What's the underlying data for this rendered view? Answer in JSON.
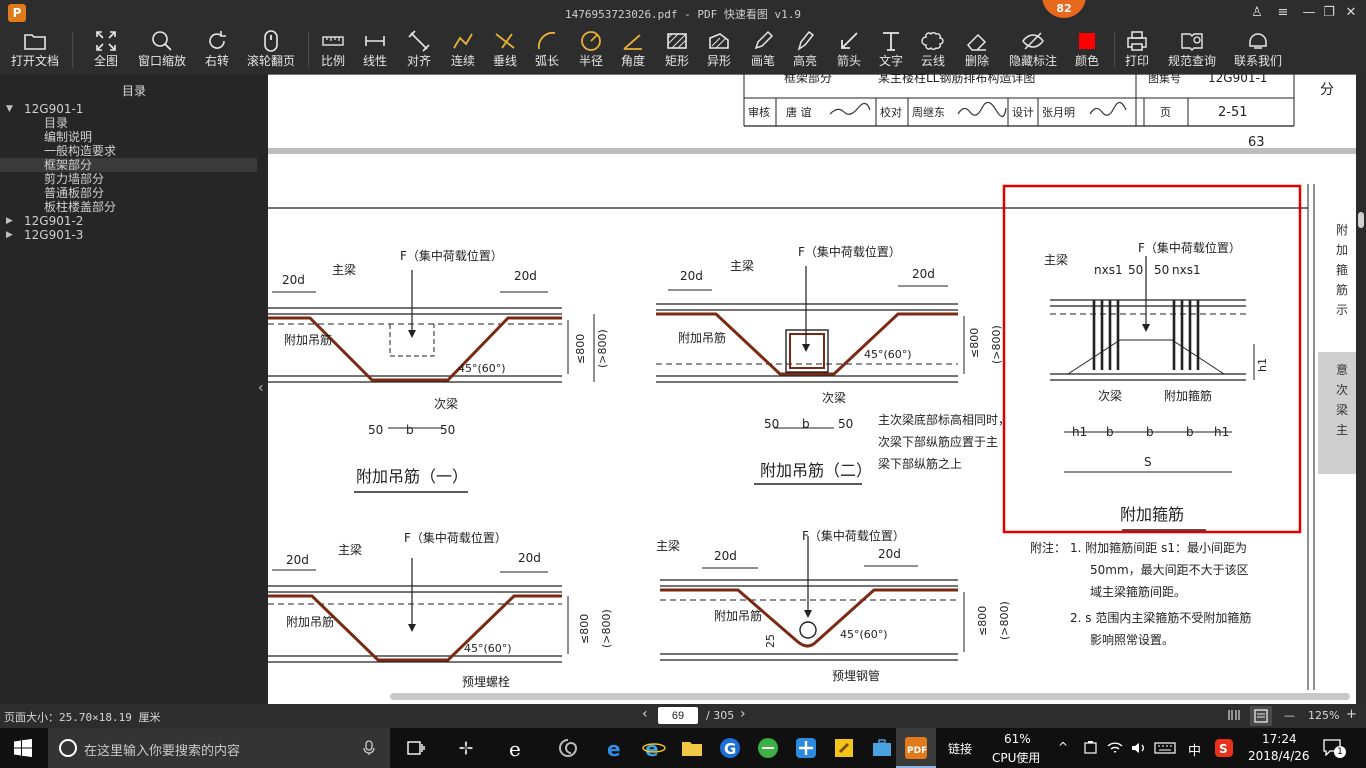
{
  "window": {
    "title": "1476953723026.pdf - PDF 快速看图 v1.9",
    "badge": "82",
    "logo": "P",
    "controls": {
      "user": "♙",
      "menu": "≡",
      "minimize": "—",
      "restore": "❐",
      "close": "✕"
    }
  },
  "toolbar": {
    "open": "打开文档",
    "fit_all": "全图",
    "window_zoom": "窗口缩放",
    "rotate_right": "右转",
    "scroll_page": "滚轮翻页",
    "scale": "比例",
    "linear": "线性",
    "align": "对齐",
    "continuous": "连续",
    "perpendicular": "垂线",
    "arc_length": "弧长",
    "radius": "半径",
    "angle": "角度",
    "rectangle": "矩形",
    "irregular": "异形",
    "pen": "画笔",
    "highlight": "高亮",
    "arrow": "箭头",
    "text": "文字",
    "cloud": "云线",
    "delete": "删除",
    "hide_marks": "隐藏标注",
    "color": "颜色",
    "print": "打印",
    "standard_query": "规范查询",
    "contact": "联系我们",
    "color_value": "#ff0000"
  },
  "sidebar": {
    "header": "目录",
    "root1": "12G901-1",
    "items": [
      "目录",
      "编制说明",
      "一般构造要求",
      "框架部分",
      "剪力墙部分",
      "普通板部分",
      "板柱楼盖部分"
    ],
    "root2": "12G901-2",
    "root3": "12G901-3"
  },
  "drawing": {
    "title_block": {
      "top_left": "框架部分",
      "top_center": "某主楼柱LL钢筋排布构造详图",
      "top_atlas": "图集号",
      "top_atlas_no": "12G901-1",
      "side": "分",
      "review": "审核",
      "reviewer": "唐 谊",
      "check": "校对",
      "checker": "周继东",
      "design": "设计",
      "designer": "张月明",
      "page": "页",
      "page_no": "2-51",
      "page_number": "63"
    },
    "labels": {
      "F_load": "F（集中荷载位置）",
      "F": "F",
      "load": "（集中荷载位置）",
      "main_beam": "主梁",
      "secondary_beam": "次梁",
      "hanger": "附加吊筋",
      "hoop": "附加箍筋",
      "d20": "20d",
      "angle": "45°(60°)",
      "le800": "≤800",
      "gt800": "(>800)",
      "d50": "50",
      "b": "b",
      "h1": "h1",
      "s": "S",
      "nxs1": "nxs1",
      "d25": "25",
      "bolt": "预埋螺栓",
      "pipe": "预埋钢管"
    },
    "captions": {
      "hanger_one": "附加吊筋（一）",
      "hanger_two": "附加吊筋（二）",
      "hoop": "附加箍筋"
    },
    "note_side": [
      "主次梁底部标高相同时，",
      "次梁下部纵筋应置于主",
      "梁下部纵筋之上"
    ],
    "notes": {
      "head": "附注：",
      "n1a": "1. 附加箍筋间距 s1：最小间距为",
      "n1b": "50mm，最大间距不大于该区",
      "n1c": "域主梁箍筋间距。",
      "n2a": "2. s 范围内主梁箍筋不受附加箍筋",
      "n2b": "影响照常设置。"
    },
    "edge_text": [
      "附",
      "加",
      "箍",
      "筋",
      "示",
      "意",
      "次",
      "梁",
      "主"
    ],
    "highlight_color": "#e00000"
  },
  "statusbar": {
    "page_size": "页面大小：25.70×18.19 厘米",
    "current_page": "69",
    "total_pages": "/ 305",
    "prev": "‹",
    "next": "›",
    "zoom": "125%",
    "zoom_out": "—",
    "zoom_in": "+"
  },
  "taskbar": {
    "search_placeholder": "在这里输入你要搜索的内容",
    "link": "链接",
    "cpu_percent": "61%",
    "cpu_label": "CPU使用",
    "ime": "中",
    "time": "17:24",
    "date": "2018/4/26",
    "notifications": "1"
  }
}
